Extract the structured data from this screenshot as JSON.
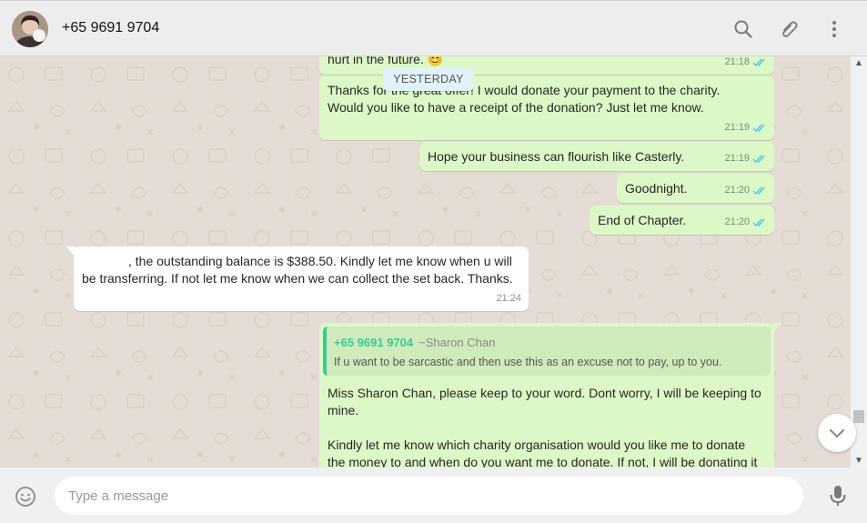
{
  "header": {
    "contact_name": "+65 9691 9704",
    "icons": [
      "search-icon",
      "attach-icon",
      "menu-icon"
    ]
  },
  "chat": {
    "date_divider": "YESTERDAY",
    "messages": [
      {
        "direction": "out",
        "text": "hurt in the future. 😊",
        "time": "21:18",
        "status": "read"
      },
      {
        "direction": "out",
        "line1": "Thanks for the great offer! I would donate your payment to the charity.",
        "line2": "Would you like to have a receipt of the donation? Just let me know.",
        "time": "21:19",
        "status": "read"
      },
      {
        "direction": "out",
        "text": "Hope your business can flourish like Casterly.",
        "time": "21:19",
        "status": "read"
      },
      {
        "direction": "out",
        "text": "Goodnight.",
        "time": "21:20",
        "status": "read"
      },
      {
        "direction": "out",
        "text": "End of Chapter.",
        "time": "21:20",
        "status": "read"
      },
      {
        "direction": "in",
        "line1": ", the outstanding balance is $388.50. Kindly let me know when u will",
        "line2": "be transferring. If not let me know when we can collect the set back. Thanks.",
        "time": "21:24"
      },
      {
        "direction": "out",
        "quoted": {
          "number": "+65 9691 9704",
          "author": "~Sharon Chan",
          "text": "If u want to be sarcastic and then use this as an excuse not to pay, up to you."
        },
        "line1": "Miss Sharon Chan, please keep to your word. Dont worry, I will be keeping to",
        "line2": "mine.",
        "line3": "Kindly let me know which charity organisation would you like me to donate",
        "line4": "the money to and when do you want me to donate. If not, I will be donating it"
      }
    ]
  },
  "composer": {
    "placeholder": "Type a message"
  },
  "colors": {
    "outgoing_bubble": "#dcf8c6",
    "incoming_bubble": "#ffffff",
    "chat_background": "#e5ddd5",
    "read_tick": "#4fc3f7",
    "quote_accent": "#35cd96"
  }
}
